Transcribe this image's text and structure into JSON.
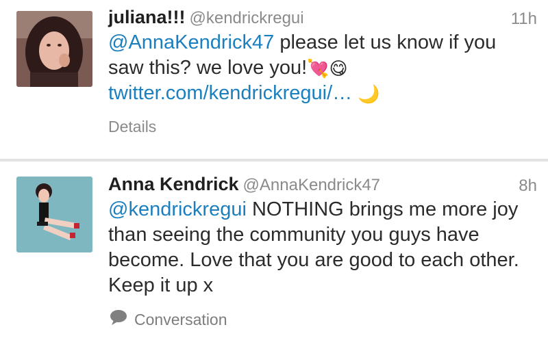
{
  "tweets": [
    {
      "name": "juliana!!!",
      "handle": "@kendrickregui",
      "time": "11h",
      "mention": "@AnnaKendrick47",
      "text": " please let us know if you saw this? we love you!",
      "emoji_1": "💘",
      "emoji_2": "😋",
      "link": "twitter.com/kendrickregui/…",
      "emoji_3": "🌙",
      "footer": "Details"
    },
    {
      "name": "Anna Kendrick",
      "handle": "@AnnaKendrick47",
      "time": "8h",
      "mention": "@kendrickregui",
      "text": " NOTHING brings me more joy than seeing the community you guys have become. Love that you are good to each other. Keep it up x",
      "footer": "Conversation",
      "footer_icon": "speech-bubble-icon"
    }
  ],
  "colors": {
    "link": "#1b7fbf",
    "muted": "#8a8a8a",
    "text": "#2b2b2b",
    "separator": "#e3e3e3"
  }
}
